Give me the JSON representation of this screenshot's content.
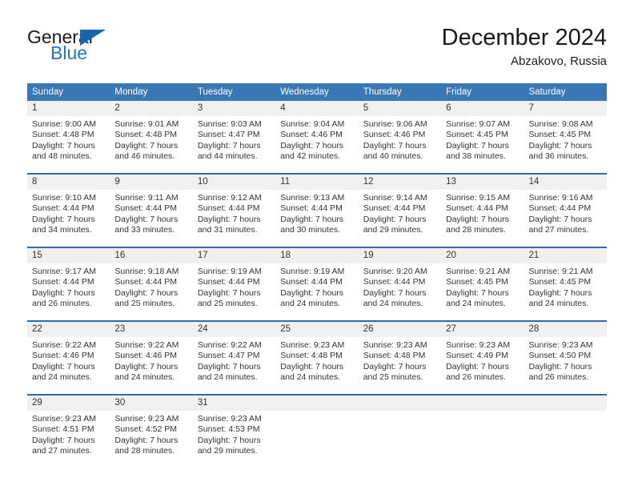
{
  "logo": {
    "word_one": "General",
    "word_two": "Blue",
    "icon": "triangle-flag-icon"
  },
  "header": {
    "title": "December 2024",
    "location": "Abzakovo, Russia"
  },
  "calendar": {
    "weekday_headers": [
      "Sunday",
      "Monday",
      "Tuesday",
      "Wednesday",
      "Thursday",
      "Friday",
      "Saturday"
    ],
    "header_bg": "#3a77b5",
    "daynum_bg": "#f0f0f0",
    "divider_color": "#2e6da4",
    "weeks": [
      [
        {
          "day": "1",
          "sunrise": "Sunrise: 9:00 AM",
          "sunset": "Sunset: 4:48 PM",
          "daylight_line1": "Daylight: 7 hours",
          "daylight_line2": "and 48 minutes."
        },
        {
          "day": "2",
          "sunrise": "Sunrise: 9:01 AM",
          "sunset": "Sunset: 4:48 PM",
          "daylight_line1": "Daylight: 7 hours",
          "daylight_line2": "and 46 minutes."
        },
        {
          "day": "3",
          "sunrise": "Sunrise: 9:03 AM",
          "sunset": "Sunset: 4:47 PM",
          "daylight_line1": "Daylight: 7 hours",
          "daylight_line2": "and 44 minutes."
        },
        {
          "day": "4",
          "sunrise": "Sunrise: 9:04 AM",
          "sunset": "Sunset: 4:46 PM",
          "daylight_line1": "Daylight: 7 hours",
          "daylight_line2": "and 42 minutes."
        },
        {
          "day": "5",
          "sunrise": "Sunrise: 9:06 AM",
          "sunset": "Sunset: 4:46 PM",
          "daylight_line1": "Daylight: 7 hours",
          "daylight_line2": "and 40 minutes."
        },
        {
          "day": "6",
          "sunrise": "Sunrise: 9:07 AM",
          "sunset": "Sunset: 4:45 PM",
          "daylight_line1": "Daylight: 7 hours",
          "daylight_line2": "and 38 minutes."
        },
        {
          "day": "7",
          "sunrise": "Sunrise: 9:08 AM",
          "sunset": "Sunset: 4:45 PM",
          "daylight_line1": "Daylight: 7 hours",
          "daylight_line2": "and 36 minutes."
        }
      ],
      [
        {
          "day": "8",
          "sunrise": "Sunrise: 9:10 AM",
          "sunset": "Sunset: 4:44 PM",
          "daylight_line1": "Daylight: 7 hours",
          "daylight_line2": "and 34 minutes."
        },
        {
          "day": "9",
          "sunrise": "Sunrise: 9:11 AM",
          "sunset": "Sunset: 4:44 PM",
          "daylight_line1": "Daylight: 7 hours",
          "daylight_line2": "and 33 minutes."
        },
        {
          "day": "10",
          "sunrise": "Sunrise: 9:12 AM",
          "sunset": "Sunset: 4:44 PM",
          "daylight_line1": "Daylight: 7 hours",
          "daylight_line2": "and 31 minutes."
        },
        {
          "day": "11",
          "sunrise": "Sunrise: 9:13 AM",
          "sunset": "Sunset: 4:44 PM",
          "daylight_line1": "Daylight: 7 hours",
          "daylight_line2": "and 30 minutes."
        },
        {
          "day": "12",
          "sunrise": "Sunrise: 9:14 AM",
          "sunset": "Sunset: 4:44 PM",
          "daylight_line1": "Daylight: 7 hours",
          "daylight_line2": "and 29 minutes."
        },
        {
          "day": "13",
          "sunrise": "Sunrise: 9:15 AM",
          "sunset": "Sunset: 4:44 PM",
          "daylight_line1": "Daylight: 7 hours",
          "daylight_line2": "and 28 minutes."
        },
        {
          "day": "14",
          "sunrise": "Sunrise: 9:16 AM",
          "sunset": "Sunset: 4:44 PM",
          "daylight_line1": "Daylight: 7 hours",
          "daylight_line2": "and 27 minutes."
        }
      ],
      [
        {
          "day": "15",
          "sunrise": "Sunrise: 9:17 AM",
          "sunset": "Sunset: 4:44 PM",
          "daylight_line1": "Daylight: 7 hours",
          "daylight_line2": "and 26 minutes."
        },
        {
          "day": "16",
          "sunrise": "Sunrise: 9:18 AM",
          "sunset": "Sunset: 4:44 PM",
          "daylight_line1": "Daylight: 7 hours",
          "daylight_line2": "and 25 minutes."
        },
        {
          "day": "17",
          "sunrise": "Sunrise: 9:19 AM",
          "sunset": "Sunset: 4:44 PM",
          "daylight_line1": "Daylight: 7 hours",
          "daylight_line2": "and 25 minutes."
        },
        {
          "day": "18",
          "sunrise": "Sunrise: 9:19 AM",
          "sunset": "Sunset: 4:44 PM",
          "daylight_line1": "Daylight: 7 hours",
          "daylight_line2": "and 24 minutes."
        },
        {
          "day": "19",
          "sunrise": "Sunrise: 9:20 AM",
          "sunset": "Sunset: 4:44 PM",
          "daylight_line1": "Daylight: 7 hours",
          "daylight_line2": "and 24 minutes."
        },
        {
          "day": "20",
          "sunrise": "Sunrise: 9:21 AM",
          "sunset": "Sunset: 4:45 PM",
          "daylight_line1": "Daylight: 7 hours",
          "daylight_line2": "and 24 minutes."
        },
        {
          "day": "21",
          "sunrise": "Sunrise: 9:21 AM",
          "sunset": "Sunset: 4:45 PM",
          "daylight_line1": "Daylight: 7 hours",
          "daylight_line2": "and 24 minutes."
        }
      ],
      [
        {
          "day": "22",
          "sunrise": "Sunrise: 9:22 AM",
          "sunset": "Sunset: 4:46 PM",
          "daylight_line1": "Daylight: 7 hours",
          "daylight_line2": "and 24 minutes."
        },
        {
          "day": "23",
          "sunrise": "Sunrise: 9:22 AM",
          "sunset": "Sunset: 4:46 PM",
          "daylight_line1": "Daylight: 7 hours",
          "daylight_line2": "and 24 minutes."
        },
        {
          "day": "24",
          "sunrise": "Sunrise: 9:22 AM",
          "sunset": "Sunset: 4:47 PM",
          "daylight_line1": "Daylight: 7 hours",
          "daylight_line2": "and 24 minutes."
        },
        {
          "day": "25",
          "sunrise": "Sunrise: 9:23 AM",
          "sunset": "Sunset: 4:48 PM",
          "daylight_line1": "Daylight: 7 hours",
          "daylight_line2": "and 24 minutes."
        },
        {
          "day": "26",
          "sunrise": "Sunrise: 9:23 AM",
          "sunset": "Sunset: 4:48 PM",
          "daylight_line1": "Daylight: 7 hours",
          "daylight_line2": "and 25 minutes."
        },
        {
          "day": "27",
          "sunrise": "Sunrise: 9:23 AM",
          "sunset": "Sunset: 4:49 PM",
          "daylight_line1": "Daylight: 7 hours",
          "daylight_line2": "and 26 minutes."
        },
        {
          "day": "28",
          "sunrise": "Sunrise: 9:23 AM",
          "sunset": "Sunset: 4:50 PM",
          "daylight_line1": "Daylight: 7 hours",
          "daylight_line2": "and 26 minutes."
        }
      ],
      [
        {
          "day": "29",
          "sunrise": "Sunrise: 9:23 AM",
          "sunset": "Sunset: 4:51 PM",
          "daylight_line1": "Daylight: 7 hours",
          "daylight_line2": "and 27 minutes."
        },
        {
          "day": "30",
          "sunrise": "Sunrise: 9:23 AM",
          "sunset": "Sunset: 4:52 PM",
          "daylight_line1": "Daylight: 7 hours",
          "daylight_line2": "and 28 minutes."
        },
        {
          "day": "31",
          "sunrise": "Sunrise: 9:23 AM",
          "sunset": "Sunset: 4:53 PM",
          "daylight_line1": "Daylight: 7 hours",
          "daylight_line2": "and 29 minutes."
        },
        {
          "day": "",
          "sunrise": "",
          "sunset": "",
          "daylight_line1": "",
          "daylight_line2": ""
        },
        {
          "day": "",
          "sunrise": "",
          "sunset": "",
          "daylight_line1": "",
          "daylight_line2": ""
        },
        {
          "day": "",
          "sunrise": "",
          "sunset": "",
          "daylight_line1": "",
          "daylight_line2": ""
        },
        {
          "day": "",
          "sunrise": "",
          "sunset": "",
          "daylight_line1": "",
          "daylight_line2": ""
        }
      ]
    ]
  }
}
